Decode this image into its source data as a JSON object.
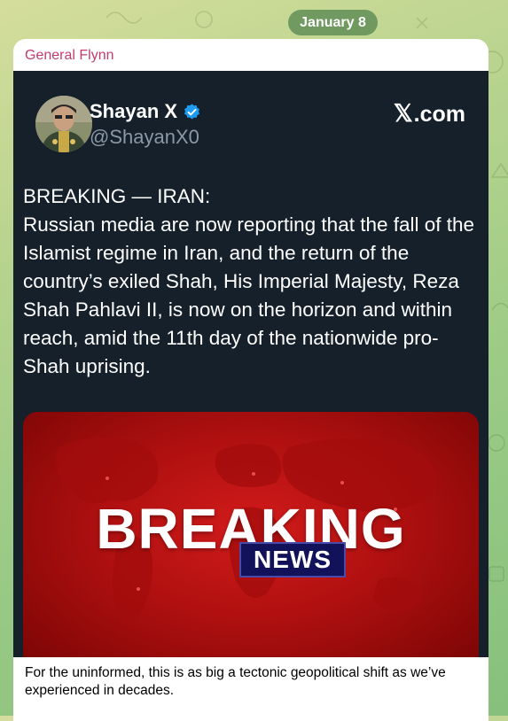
{
  "chat": {
    "date": "January 8",
    "sender": "General Flynn",
    "caption": "For the uninformed, this is as big a tectonic geopolitical shift as we’ve experienced in decades."
  },
  "tweet": {
    "display_name": "Shayan X",
    "handle": "@ShayanX0",
    "brand_mark": "𝕏",
    "brand_text": ".com",
    "headline": "BREAKING — IRAN:",
    "body": "Russian media are now reporting that the fall of the Islamist regime in Iran, and the return of the country’s exiled Shah, His Imperial Majesty, Reza Shah Pahlavi II, is now on the horizon and within reach, amid the 11th day of the nationwide pro-Shah uprising."
  },
  "media": {
    "breaking_text": "BREAKING",
    "news_text": "NEWS"
  },
  "colors": {
    "sender": "#c03d6d",
    "tweet_bg": "#15202b",
    "handle": "#8b98a5",
    "verified": "#1d9bf0",
    "media_red": "#c41414",
    "news_box": "#12125a"
  },
  "icons": [
    "verified-badge-icon",
    "x-logo-icon"
  ]
}
